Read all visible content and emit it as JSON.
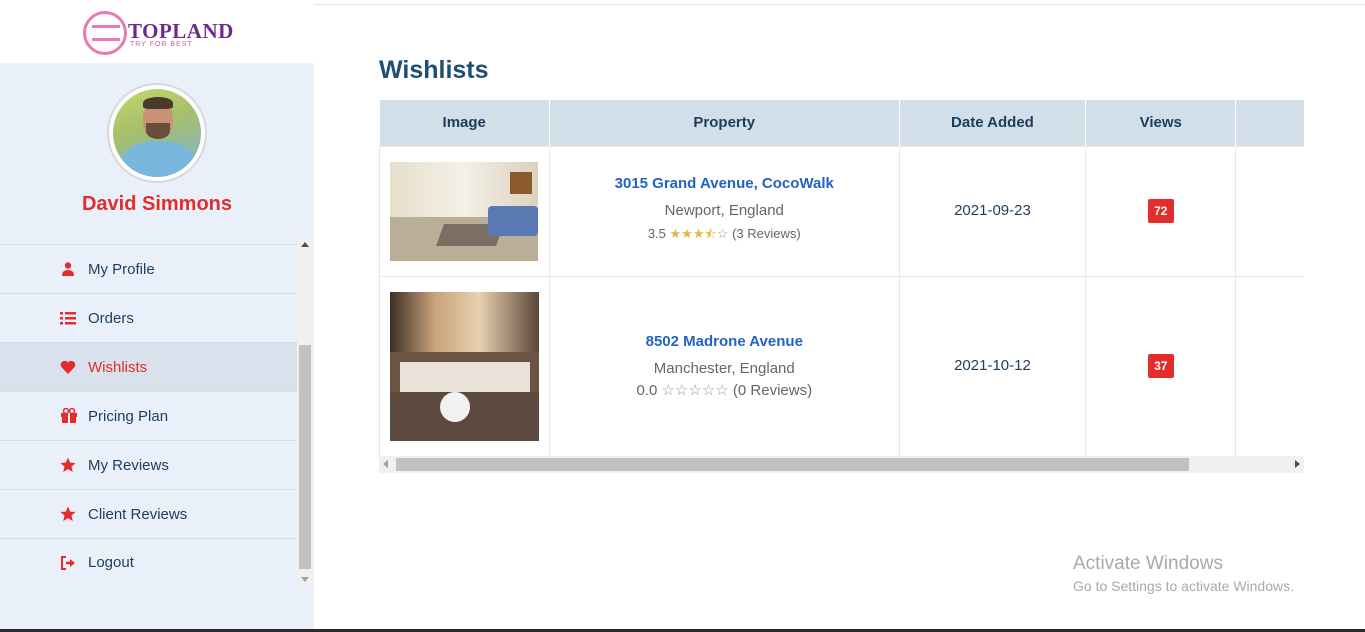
{
  "brand": {
    "name": "TOPLAND",
    "tagline": "TRY FOR BEST"
  },
  "user": {
    "name": "David Simmons"
  },
  "sidebar": {
    "items": [
      {
        "label": "My Profile",
        "icon": "user-icon"
      },
      {
        "label": "Orders",
        "icon": "list-icon"
      },
      {
        "label": "Wishlists",
        "icon": "heart-icon",
        "active": true
      },
      {
        "label": "Pricing Plan",
        "icon": "gift-icon"
      },
      {
        "label": "My Reviews",
        "icon": "star-icon"
      },
      {
        "label": "Client Reviews",
        "icon": "star-icon"
      },
      {
        "label": "Logout",
        "icon": "logout-icon"
      }
    ]
  },
  "page": {
    "title": "Wishlists"
  },
  "table": {
    "headers": [
      "Image",
      "Property",
      "Date Added",
      "Views"
    ],
    "rows": [
      {
        "title": "3015 Grand Avenue, CocoWalk",
        "location": "Newport, England",
        "rating": "3.5",
        "reviews": "(3 Reviews)",
        "date": "2021-09-23",
        "views": "72"
      },
      {
        "title": "8502 Madrone Avenue",
        "location": "Manchester, England",
        "rating": "0.0",
        "reviews": "(0 Reviews)",
        "date": "2021-10-12",
        "views": "37"
      }
    ]
  },
  "watermark": {
    "title": "Activate Windows",
    "subtitle": "Go to Settings to activate Windows."
  },
  "colors": {
    "accent": "#e32d2d",
    "heading": "#1d4f73",
    "link": "#2463c4",
    "sidebar_bg": "#eaf0fa",
    "table_header_bg": "#d2dfe8"
  }
}
